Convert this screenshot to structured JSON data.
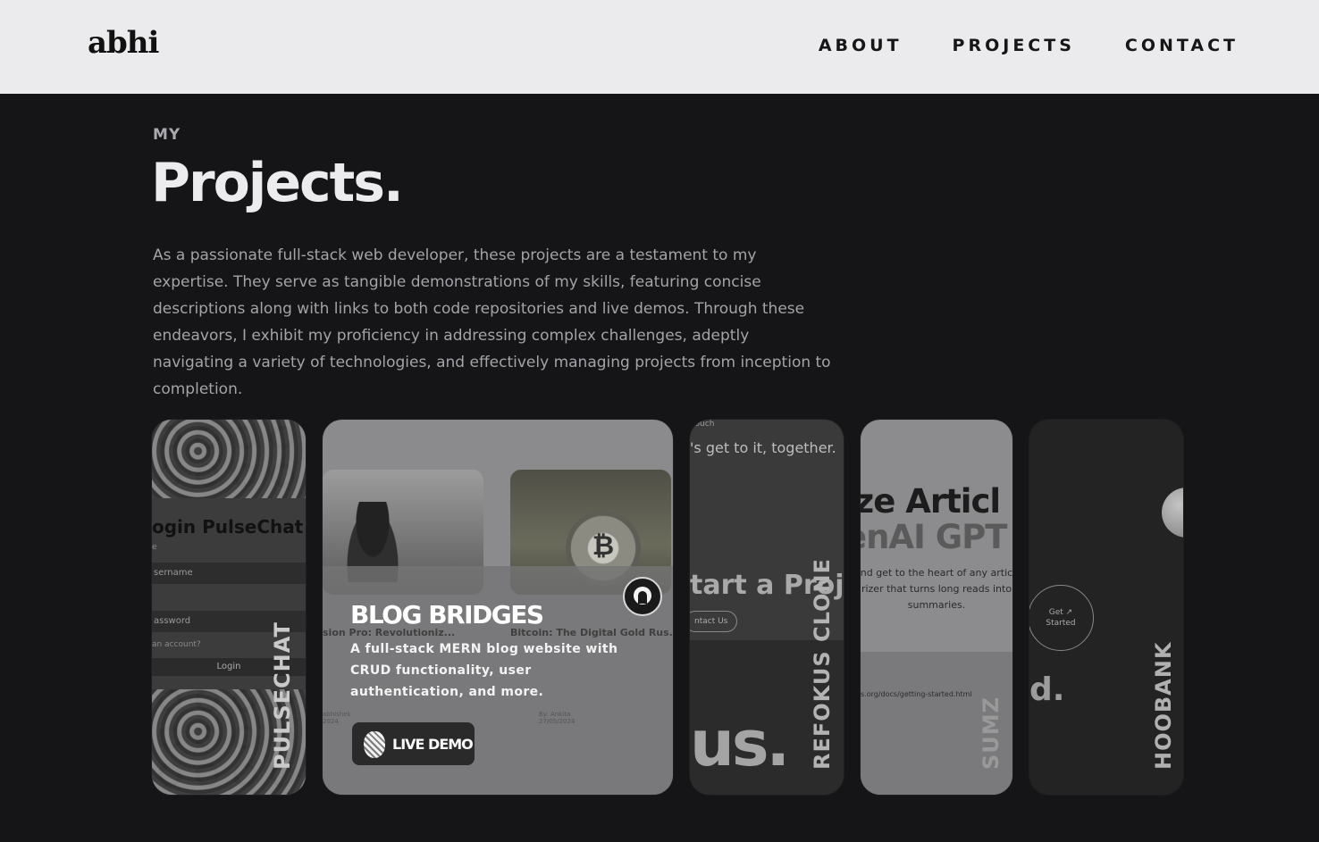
{
  "header": {
    "logo": "abhi",
    "nav": [
      "ABOUT",
      "PROJECTS",
      "CONTACT"
    ]
  },
  "intro": {
    "eyebrow": "MY",
    "title": "Projects.",
    "description": "As a passionate full-stack web developer, these projects are a testament to my expertise. They serve as tangible demonstrations of my skills, featuring concise descriptions along with links to both code repositories and live demos. Through these endeavors, I exhibit my proficiency in addressing complex challenges, adeptly navigating a variety of technologies, and effectively managing projects from inception to completion."
  },
  "projects": [
    {
      "label": "PULSECHAT",
      "preview": {
        "title_a": "ogin ",
        "title_b": "PulseChat",
        "hint": "e",
        "username": "sername",
        "password": "assword",
        "account": "an account?",
        "login": "Login"
      }
    },
    {
      "name": "BLOG BRIDGES",
      "description": "A full-stack MERN blog website with CRUD functionality, user authentication, and more.",
      "live_demo": "LIVE DEMO",
      "preview": {
        "post1": "sion Pro: Revolutioniz...",
        "post2": "Bitcoin: The Digital Gold Rus...",
        "coin_glyph": "₿",
        "author1": "abhishek\n2024",
        "author2": "By: Ankita\n27/05/2024"
      }
    },
    {
      "label": "REFOKUS CLONE",
      "preview": {
        "line1": "touch",
        "line2": "'s get to it, together.",
        "line3": "tart a Proje",
        "pill": "ntact Us",
        "big": "us."
      }
    },
    {
      "label": "SUMZ",
      "preview": {
        "h1": "ize Articl",
        "h2": "enAI GPT",
        "p": "nd get to the heart of any artic rizer that turns long reads into summaries.",
        "url": "s.org/docs/getting-started.html"
      }
    },
    {
      "label": "HOOBANK",
      "preview": {
        "ring": "Get ↗\nStarted",
        "d": "d."
      }
    }
  ]
}
